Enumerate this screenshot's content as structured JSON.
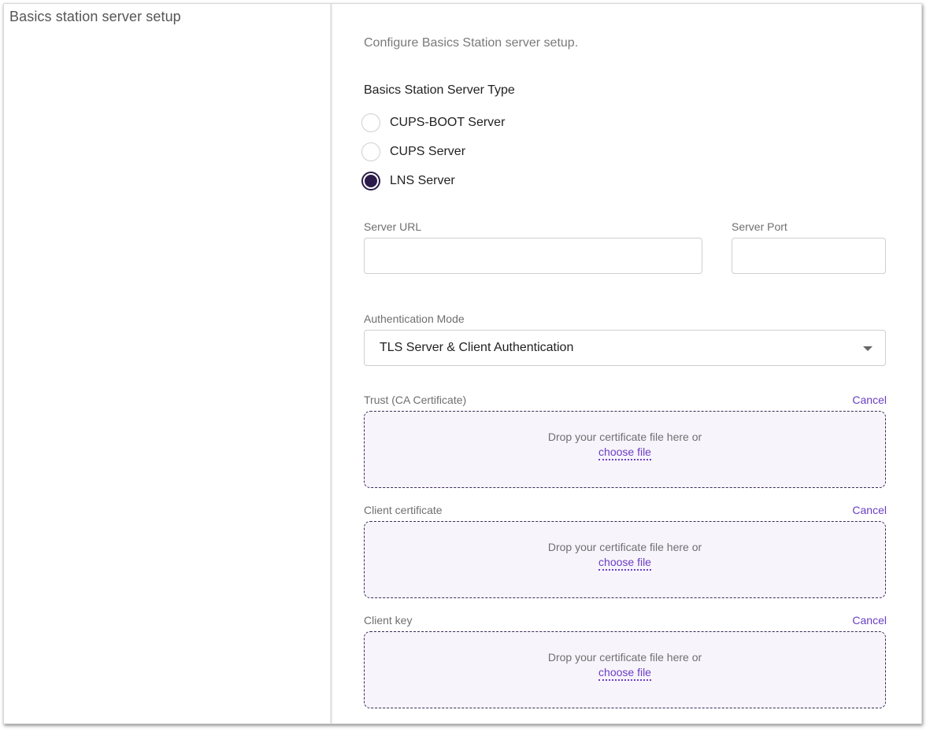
{
  "section": {
    "title": "Basics station server setup"
  },
  "form": {
    "intro": "Configure Basics Station server setup.",
    "server_type": {
      "label": "Basics Station Server Type",
      "options": [
        {
          "label": "CUPS-BOOT Server",
          "checked": false
        },
        {
          "label": "CUPS Server",
          "checked": false
        },
        {
          "label": "LNS Server",
          "checked": true
        }
      ]
    },
    "server_url": {
      "label": "Server URL",
      "value": "",
      "placeholder": ""
    },
    "server_port": {
      "label": "Server Port",
      "value": "",
      "placeholder": ""
    },
    "auth_mode": {
      "label": "Authentication Mode",
      "value": "TLS Server & Client Authentication"
    },
    "certificates": [
      {
        "label": "Trust (CA Certificate)",
        "cancel": "Cancel",
        "drop_text": "Drop your certificate file here or",
        "choose_text": "choose file"
      },
      {
        "label": "Client certificate",
        "cancel": "Cancel",
        "drop_text": "Drop your certificate file here or",
        "choose_text": "choose file"
      },
      {
        "label": "Client key",
        "cancel": "Cancel",
        "drop_text": "Drop your certificate file here or",
        "choose_text": "choose file"
      }
    ]
  },
  "colors": {
    "accent": "#6a3fc2",
    "radio_selected": "#2b1a4a",
    "dropzone_bg": "#f8f4fc"
  },
  "icons": {
    "select_caret": "chevron-down-icon"
  }
}
